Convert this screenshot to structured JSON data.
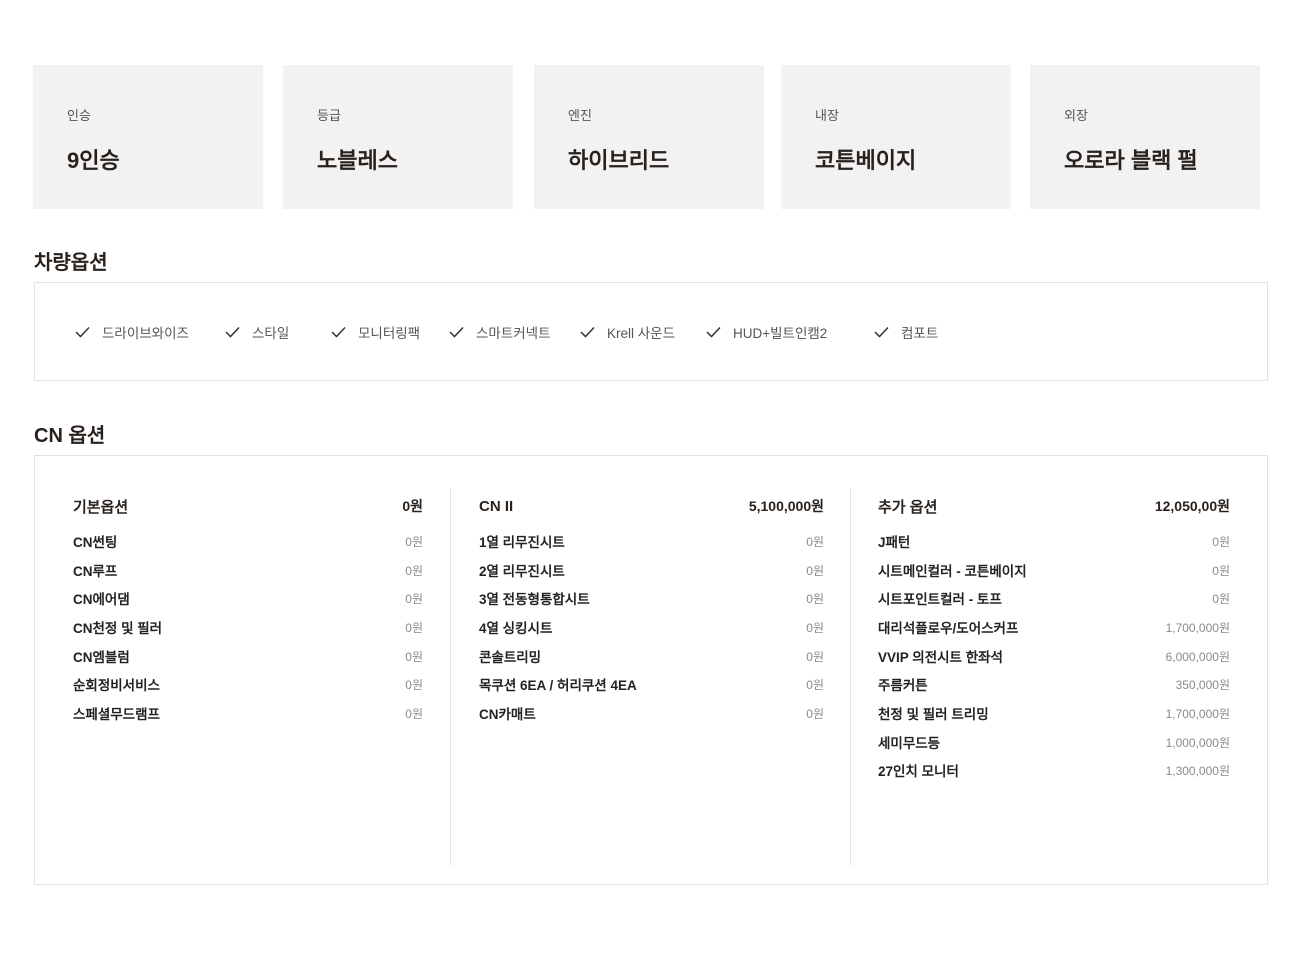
{
  "specs": [
    {
      "label": "인승",
      "value": "9인승"
    },
    {
      "label": "등급",
      "value": "노블레스"
    },
    {
      "label": "엔진",
      "value": "하이브리드"
    },
    {
      "label": "내장",
      "value": "코튼베이지"
    },
    {
      "label": "외장",
      "value": "오로라 블랙 펄"
    }
  ],
  "vehicle_options": {
    "title": "차량옵션",
    "items": [
      "드라이브와이즈",
      "스타일",
      "모니터링팩",
      "스마트커넥트",
      "Krell 사운드",
      "HUD+빌트인캠2",
      "컴포트"
    ]
  },
  "cn_options": {
    "title": "CN 옵션",
    "columns": [
      {
        "title": "기본옵션",
        "total": "0원",
        "rows": [
          {
            "name": "CN썬팅",
            "price": "0원"
          },
          {
            "name": "CN루프",
            "price": "0원"
          },
          {
            "name": "CN에어댐",
            "price": "0원"
          },
          {
            "name": "CN천정 및 필러",
            "price": "0원"
          },
          {
            "name": "CN엠블럼",
            "price": "0원"
          },
          {
            "name": "순회정비서비스",
            "price": "0원"
          },
          {
            "name": "스페셜무드램프",
            "price": "0원"
          }
        ]
      },
      {
        "title": "CN II",
        "total": "5,100,000원",
        "rows": [
          {
            "name": "1열 리무진시트",
            "price": "0원"
          },
          {
            "name": "2열 리무진시트",
            "price": "0원"
          },
          {
            "name": "3열 전동형통합시트",
            "price": "0원"
          },
          {
            "name": "4열 싱킹시트",
            "price": "0원"
          },
          {
            "name": "콘솔트리밍",
            "price": "0원"
          },
          {
            "name": "목쿠션 6EA / 허리쿠션 4EA",
            "price": "0원"
          },
          {
            "name": "CN카매트",
            "price": "0원"
          }
        ]
      },
      {
        "title": "추가 옵션",
        "total": "12,050,00원",
        "rows": [
          {
            "name": "J패턴",
            "price": "0원"
          },
          {
            "name": "시트메인컬러 - 코튼베이지",
            "price": "0원"
          },
          {
            "name": "시트포인트컬러 - 토프",
            "price": "0원"
          },
          {
            "name": "대리석플로우/도어스커프",
            "price": "1,700,000원"
          },
          {
            "name": "VVIP 의전시트 한좌석",
            "price": "6,000,000원"
          },
          {
            "name": "주름커튼",
            "price": "350,000원"
          },
          {
            "name": "천정 및 필러 트리밍",
            "price": "1,700,000원"
          },
          {
            "name": "세미무드등",
            "price": "1,000,000원"
          },
          {
            "name": "27인치 모니터",
            "price": "1,300,000원"
          }
        ]
      }
    ]
  },
  "icons": {
    "check": "check-icon"
  },
  "colors": {
    "card_bg": "#f2f2f2",
    "title_text": "#2a211c",
    "border": "#e2e2e2",
    "muted_text": "#8a8a8a"
  }
}
